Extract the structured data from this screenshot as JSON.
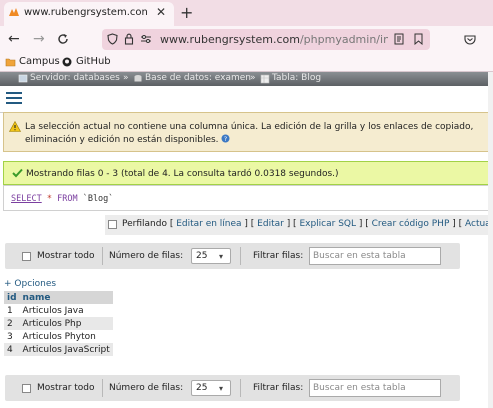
{
  "browser": {
    "tab_title": "www.rubengrsystem.con",
    "tab_close": "✕",
    "new_tab": "+",
    "url_host": "www.rubengrsystem.com",
    "url_path": "/phpmyadmin/index.ph",
    "bookmarks": [
      {
        "label": "Campus"
      },
      {
        "label": "GitHub"
      }
    ]
  },
  "breadcrumb": {
    "server": "Servidor: databases",
    "database": "Base de datos: examen",
    "table": "Tabla: Blog",
    "separator": "»"
  },
  "notice": {
    "text": "La selección actual no contiene una columna única. La edición de la grilla y los enlaces de copiado, eliminación y edición no están disponibles."
  },
  "success": {
    "text": "Mostrando filas 0 - 3 (total de 4. La consulta tardó 0.0318 segundos.)"
  },
  "sql": {
    "select": "SELECT",
    "star": "*",
    "from": "FROM",
    "table": "`Blog`"
  },
  "profiling": {
    "label": "Perfilando",
    "links": [
      "Editar en línea",
      "Editar",
      "Explicar SQL",
      "Crear código PHP",
      "Actualiza"
    ]
  },
  "nav_top": {
    "show_all": "Mostrar todo",
    "rows_label": "Número de filas:",
    "rows_value": "25",
    "filter_label": "Filtrar filas:",
    "filter_placeholder": "Buscar en esta tabla"
  },
  "nav_bottom": {
    "show_all": "Mostrar todo",
    "rows_label": "Número de filas:",
    "rows_value": "25",
    "filter_label": "Filtrar filas:",
    "filter_placeholder": "Buscar en esta tabla"
  },
  "options_link": "+ Opciones",
  "table": {
    "columns": [
      "id",
      "name"
    ],
    "rows": [
      [
        "1",
        "Articulos Java"
      ],
      [
        "2",
        "Articulos Php"
      ],
      [
        "3",
        "Articulos Phyton"
      ],
      [
        "4",
        "Articulos JavaScript"
      ]
    ]
  },
  "colors": {
    "accent_link": "#235a81",
    "tab_strip": "#f2dde5",
    "success_bg": "#ebf8a4",
    "notice_bg": "#f5ecd0"
  }
}
